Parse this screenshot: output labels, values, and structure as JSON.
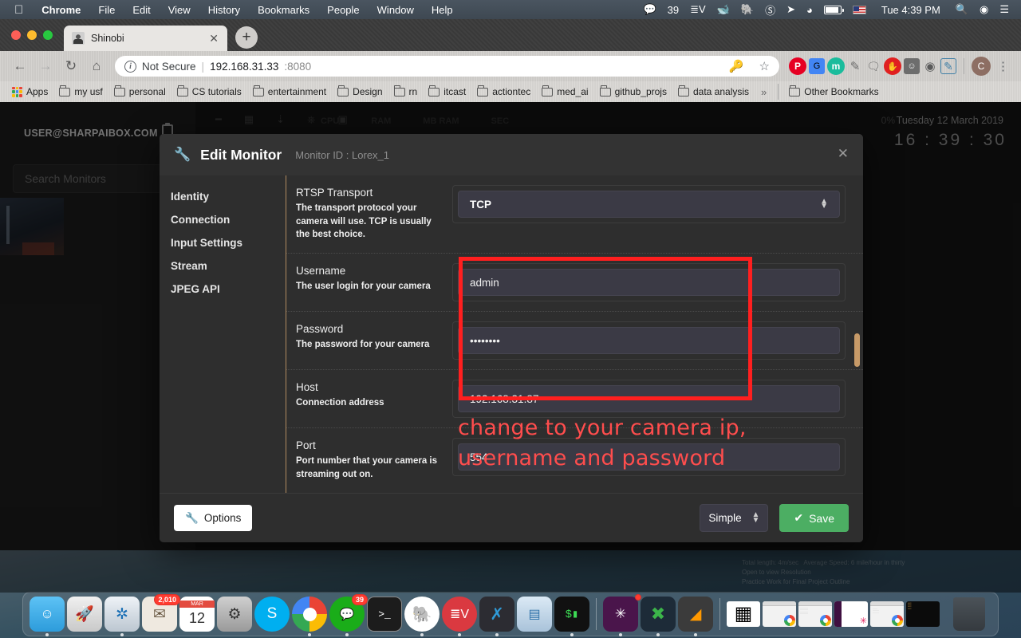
{
  "menubar": {
    "apple_icon": "apple-icon",
    "items": [
      {
        "label": "Chrome",
        "bold": true
      },
      {
        "label": "File",
        "bold": false
      },
      {
        "label": "Edit",
        "bold": false
      },
      {
        "label": "View",
        "bold": false
      },
      {
        "label": "History",
        "bold": false
      },
      {
        "label": "Bookmarks",
        "bold": false
      },
      {
        "label": "People",
        "bold": false
      },
      {
        "label": "Window",
        "bold": false
      },
      {
        "label": "Help",
        "bold": false
      }
    ],
    "status": {
      "wechat_icon": "wechat-icon",
      "wechat_count": "39",
      "sublime_icon": "sublime-merge-icon",
      "docker_icon": "docker-icon",
      "evernote_icon": "evernote-icon",
      "skype_icon": "skype-icon",
      "location_icon": "location-arrow-icon",
      "wifi_icon": "wifi-icon",
      "battery_icon": "battery-charging-icon",
      "input_flag_icon": "us-flag-icon",
      "clock": "Tue 4:39 PM",
      "search_icon": "spotlight-search-icon",
      "siri_icon": "siri-icon",
      "control_center_icon": "notification-center-icon"
    }
  },
  "browser": {
    "tab": {
      "title": "Shinobi",
      "favicon": "shinobi-favicon",
      "close_icon": "close-icon"
    },
    "new_tab_label": "+",
    "nav": {
      "back_icon": "back-arrow-icon",
      "forward_icon": "forward-arrow-icon",
      "reload_icon": "reload-icon",
      "home_icon": "home-icon"
    },
    "omnibox": {
      "security_icon": "info-circle-icon",
      "security_label": "Not Secure",
      "separator": "|",
      "url_host": "192.168.31.33",
      "url_port": ":8080",
      "key_icon": "password-key-icon",
      "bookmark_icon": "star-icon"
    },
    "extensions": [
      {
        "name": "pinterest-extension-icon",
        "glyph": "P",
        "color": "#e60023",
        "shape": "circle"
      },
      {
        "name": "google-translate-extension-icon",
        "glyph": "G",
        "color": "#4285f4",
        "shape": "square"
      },
      {
        "name": "momentum-extension-icon",
        "glyph": "m",
        "color": "#1abc9c",
        "shape": "circle"
      },
      {
        "name": "highlighter-extension-icon",
        "glyph": "✎",
        "color": "#7d7d7d",
        "shape": "plain"
      },
      {
        "name": "chat-extension-icon",
        "glyph": "◕",
        "color": "#6b6b6b",
        "shape": "plain"
      },
      {
        "name": "adblock-extension-icon",
        "glyph": "✋",
        "color": "#e02020",
        "shape": "circle"
      },
      {
        "name": "ghostery-extension-icon",
        "glyph": "☻",
        "color": "#5a5a5a",
        "shape": "plain"
      },
      {
        "name": "wayback-extension-icon",
        "glyph": "◍",
        "color": "#4a4a4a",
        "shape": "plain"
      },
      {
        "name": "notes-extension-icon",
        "glyph": "✐",
        "color": "#3f7fa6",
        "shape": "plain"
      }
    ],
    "profile_initial": "C",
    "menu_icon": "chrome-menu-icon",
    "bookmarks": {
      "apps_label": "Apps",
      "apps_icon": "apps-grid-icon",
      "items": [
        {
          "label": "my usf"
        },
        {
          "label": "personal"
        },
        {
          "label": "CS tutorials"
        },
        {
          "label": "entertainment"
        },
        {
          "label": "Design"
        },
        {
          "label": "rn"
        },
        {
          "label": "itcast"
        },
        {
          "label": "actiontec"
        },
        {
          "label": "med_ai"
        },
        {
          "label": "github_projs"
        },
        {
          "label": "data analysis"
        }
      ],
      "overflow_label": "»",
      "other_label": "Other Bookmarks"
    }
  },
  "app": {
    "user_email": "USER@SHARPAIBOX.COM",
    "clipboard_icon": "clipboard-icon",
    "search_placeholder": "Search Monitors",
    "monitor_thumb": "monitor-thumbnail",
    "top_stats": [
      "CPU",
      "RAM",
      "MB RAM",
      "SEC"
    ],
    "percent": "0%",
    "date": "Tuesday 12 March 2019",
    "time": "16 : 39 : 30"
  },
  "modal": {
    "wrench_icon": "wrench-icon",
    "title": "Edit Monitor",
    "monitor_id": "Monitor ID : Lorex_1",
    "close_icon": "close-icon",
    "nav_items": [
      {
        "label": "Identity"
      },
      {
        "label": "Connection"
      },
      {
        "label": "Input Settings"
      },
      {
        "label": "Stream"
      },
      {
        "label": "JPEG API"
      }
    ],
    "fields": [
      {
        "name": "rtsp-transport",
        "label": "RTSP Transport",
        "description": "The transport protocol your camera will use. TCP is usually the best choice.",
        "type": "select",
        "value": "TCP"
      },
      {
        "name": "username",
        "label": "Username",
        "description": "The user login for your camera",
        "type": "text",
        "value": "admin"
      },
      {
        "name": "password",
        "label": "Password",
        "description": "The password for your camera",
        "type": "password",
        "value": "••••••••"
      },
      {
        "name": "host",
        "label": "Host",
        "description": "Connection address",
        "type": "text",
        "value": "192.168.31.87"
      },
      {
        "name": "port",
        "label": "Port",
        "description": "Port number that your camera is streaming out on.",
        "type": "text",
        "value": "554"
      }
    ],
    "footer": {
      "options_label": "Options",
      "options_icon": "wrench-icon",
      "mode_value": "Simple",
      "save_label": "Save",
      "save_icon": "check-icon",
      "save_color": "#4cae63"
    }
  },
  "annotation": {
    "color": "#ff4d4d",
    "box_color": "#ff1f1f",
    "line1": "change to your camera ip,",
    "line2": "username and password"
  },
  "dock": {
    "items": [
      {
        "name": "finder",
        "glyph": "☺",
        "color": "#2d9cdb",
        "running": true
      },
      {
        "name": "launchpad",
        "glyph": "🚀",
        "color": "#d9d9d9",
        "running": false
      },
      {
        "name": "safari",
        "glyph": "◎",
        "color": "#cfd6dc",
        "running": false
      },
      {
        "name": "mail",
        "glyph": "✉",
        "color": "#e8e8e8",
        "running": true,
        "badge": "2,010"
      },
      {
        "name": "calendar",
        "glyph": "12",
        "color": "#ffffff",
        "running": false,
        "sublabel": "MAR"
      },
      {
        "name": "system-preferences",
        "glyph": "⚙",
        "color": "#9a9a9a",
        "running": false
      },
      {
        "name": "skype",
        "glyph": "S",
        "color": "#00aff0",
        "running": false
      },
      {
        "name": "chrome",
        "glyph": "◉",
        "color": "#4285f4",
        "running": true
      },
      {
        "name": "wechat",
        "glyph": "💬",
        "color": "#1aad19",
        "running": true,
        "badge": "39"
      },
      {
        "name": "terminal",
        "glyph": ">_",
        "color": "#1c1c1c",
        "running": false
      },
      {
        "name": "evernote",
        "glyph": "🐘",
        "color": "#00a82d",
        "running": true
      },
      {
        "name": "expressvpn",
        "glyph": "≡V",
        "color": "#da3940",
        "running": true
      },
      {
        "name": "vs-code",
        "glyph": "X",
        "color": "#2c2c32",
        "running": true
      },
      {
        "name": "keynote",
        "glyph": "▦",
        "color": "#3aa0dd",
        "running": false
      },
      {
        "name": "iterm",
        "glyph": "$",
        "color": "#111111",
        "running": true
      },
      {
        "name": "slack",
        "glyph": "✳",
        "color": "#611f69",
        "running": true,
        "badge": ""
      },
      {
        "name": "xmind",
        "glyph": "✗",
        "color": "#3cb54a",
        "running": true
      },
      {
        "name": "sublime-text",
        "glyph": "◤",
        "color": "#3b3b3b",
        "running": true
      }
    ],
    "minimized": [
      {
        "name": "qr-code-window"
      },
      {
        "name": "chrome-window-blank"
      },
      {
        "name": "chrome-window-doc"
      },
      {
        "name": "slack-window"
      },
      {
        "name": "chrome-window-article"
      },
      {
        "name": "terminal-window"
      }
    ],
    "trash": {
      "name": "trash"
    }
  }
}
